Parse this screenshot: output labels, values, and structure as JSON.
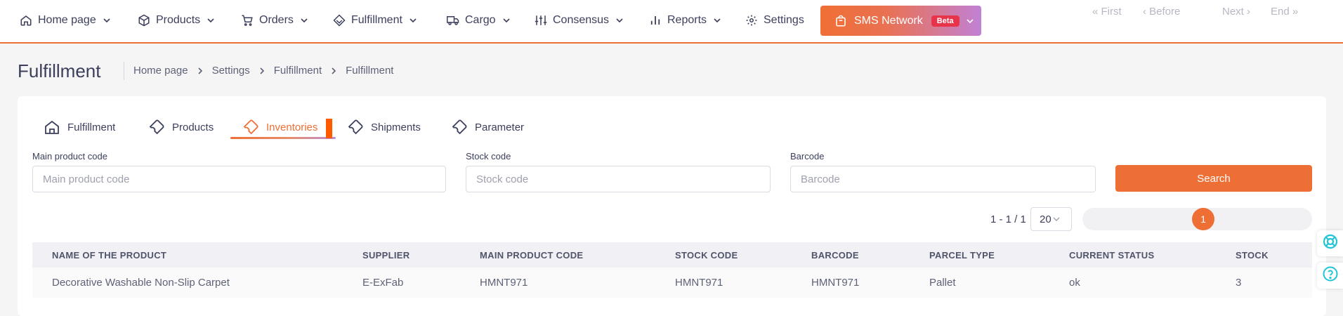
{
  "nav": {
    "items": [
      {
        "label": "Home page",
        "icon": "home-icon",
        "has_dropdown": true
      },
      {
        "label": "Products",
        "icon": "box-icon",
        "has_dropdown": true
      },
      {
        "label": "Orders",
        "icon": "cart-icon",
        "has_dropdown": true
      },
      {
        "label": "Fulfillment",
        "icon": "stack-icon",
        "has_dropdown": true
      },
      {
        "label": "Cargo",
        "icon": "truck-icon",
        "has_dropdown": true
      },
      {
        "label": "Consensus",
        "icon": "sliders-icon",
        "has_dropdown": true
      },
      {
        "label": "Reports",
        "icon": "bar-chart-icon",
        "has_dropdown": true
      },
      {
        "label": "Settings",
        "icon": "gear-icon",
        "has_dropdown": false
      }
    ],
    "sms": {
      "label": "SMS Network",
      "badge": "Beta",
      "icon": "bag-icon"
    }
  },
  "header": {
    "title": "Fulfillment",
    "breadcrumb": [
      "Home page",
      "Settings",
      "Fulfillment",
      "Fulfillment"
    ]
  },
  "tabs": [
    {
      "label": "Fulfillment",
      "icon": "home-icon",
      "active": false
    },
    {
      "label": "Products",
      "icon": "wrench-icon",
      "active": false
    },
    {
      "label": "Inventories",
      "icon": "wrench-icon",
      "active": true
    },
    {
      "label": "Shipments",
      "icon": "wrench-icon",
      "active": false
    },
    {
      "label": "Parameter",
      "icon": "wrench-icon",
      "active": false
    }
  ],
  "filters": {
    "main_product_code": {
      "label": "Main product code",
      "placeholder": "Main product code",
      "value": ""
    },
    "stock_code": {
      "label": "Stock code",
      "placeholder": "Stock code",
      "value": ""
    },
    "barcode": {
      "label": "Barcode",
      "placeholder": "Barcode",
      "value": ""
    },
    "search_label": "Search"
  },
  "pagination": {
    "range": "1 - 1 / 1",
    "page_size": "20",
    "first": "« First",
    "before": "‹ Before",
    "current": "1",
    "next": "Next ›",
    "end": "End »"
  },
  "table": {
    "columns": [
      "NAME OF THE PRODUCT",
      "SUPPLIER",
      "MAIN PRODUCT CODE",
      "STOCK CODE",
      "BARCODE",
      "PARCEL TYPE",
      "CURRENT STATUS",
      "STOCK"
    ],
    "rows": [
      [
        "Decorative Washable Non-Slip Carpet",
        "E-ExFab",
        "HMNT971",
        "HMNT971",
        "HMNT971",
        "Pallet",
        "ok",
        "3"
      ]
    ]
  },
  "floating": {
    "support_icon": "lifebuoy-icon",
    "help_icon": "question-icon"
  },
  "colors": {
    "accent": "#ee6f35",
    "text": "#3b3f5c",
    "float_icon": "#20c4d6"
  }
}
